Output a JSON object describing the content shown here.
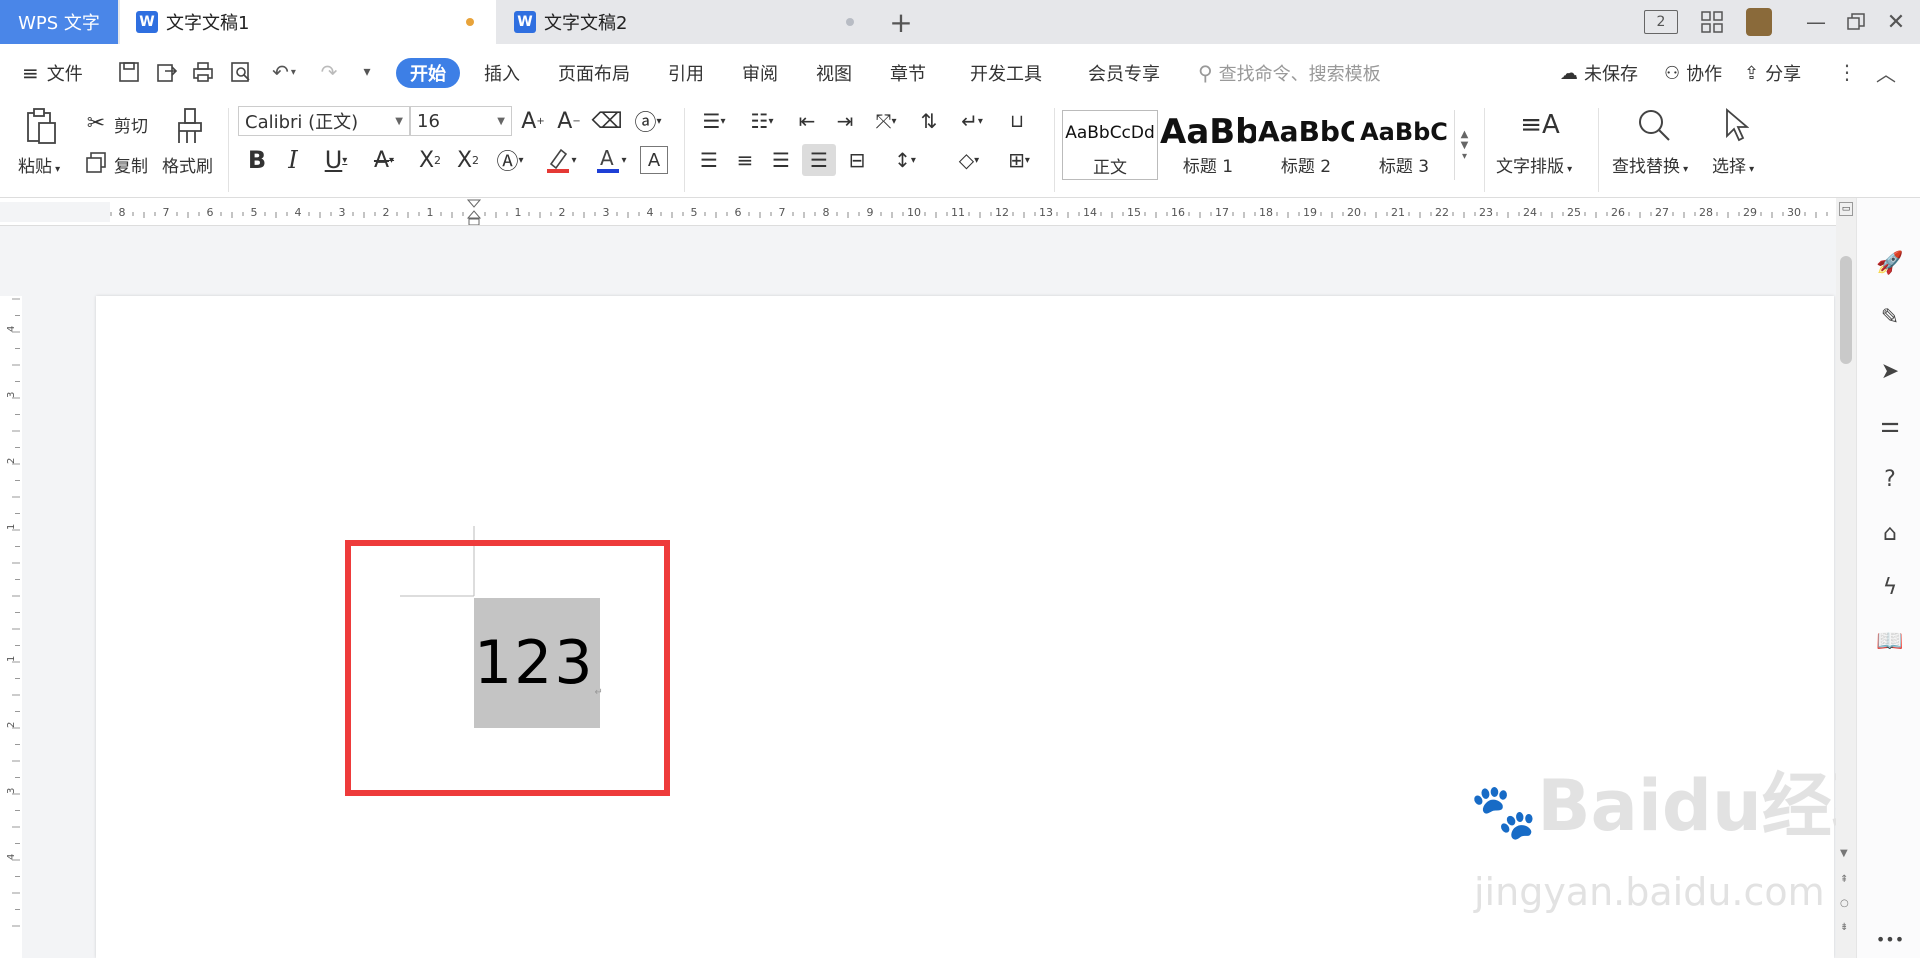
{
  "tabs": {
    "app": "WPS 文字",
    "docs": [
      {
        "label": "文字文稿1",
        "dot_color": "#e8a33a"
      },
      {
        "label": "文字文稿2",
        "dot_color": "#b8bcc4"
      }
    ],
    "add": "+",
    "page_indicator": "2"
  },
  "menu": {
    "file": "文件",
    "items": [
      "开始",
      "插入",
      "页面布局",
      "引用",
      "审阅",
      "视图",
      "章节",
      "开发工具",
      "会员专享"
    ],
    "search_placeholder": "查找命令、搜索模板",
    "unsaved": "未保存",
    "collab": "协作",
    "share": "分享"
  },
  "ribbon": {
    "paste": "粘贴",
    "cut": "剪切",
    "copy": "复制",
    "format_painter": "格式刷",
    "font_name": "Calibri (正文)",
    "font_size": "16",
    "styles": [
      {
        "preview": "AaBbCcDd",
        "name": "正文"
      },
      {
        "preview": "AaBb",
        "name": "标题 1"
      },
      {
        "preview": "AaBbC",
        "name": "标题 2"
      },
      {
        "preview": "AaBbC",
        "name": "标题 3"
      }
    ],
    "text_layout": "文字排版",
    "find_replace": "查找替换",
    "select": "选择"
  },
  "ruler": {
    "left_ticks": [
      "8",
      "7",
      "6",
      "5",
      "4",
      "3",
      "2",
      "1"
    ],
    "right_ticks": [
      "1",
      "2",
      "3",
      "4",
      "5",
      "6",
      "7",
      "8",
      "9",
      "10",
      "11",
      "12",
      "13",
      "14",
      "15",
      "16",
      "17",
      "18",
      "19",
      "20",
      "21",
      "22",
      "23",
      "24",
      "25",
      "26",
      "27",
      "28",
      "29",
      "30"
    ],
    "vertical_ticks": [
      "4",
      "3",
      "2",
      "1",
      "1",
      "2",
      "3",
      "4"
    ]
  },
  "document": {
    "text": "123"
  },
  "watermark": {
    "main": "Baidu经验",
    "sub": "jingyan.baidu.com"
  },
  "colors": {
    "accent": "#3d7fe6",
    "highlight_box": "#ee3b3b",
    "selection": "#c4c4c4"
  }
}
